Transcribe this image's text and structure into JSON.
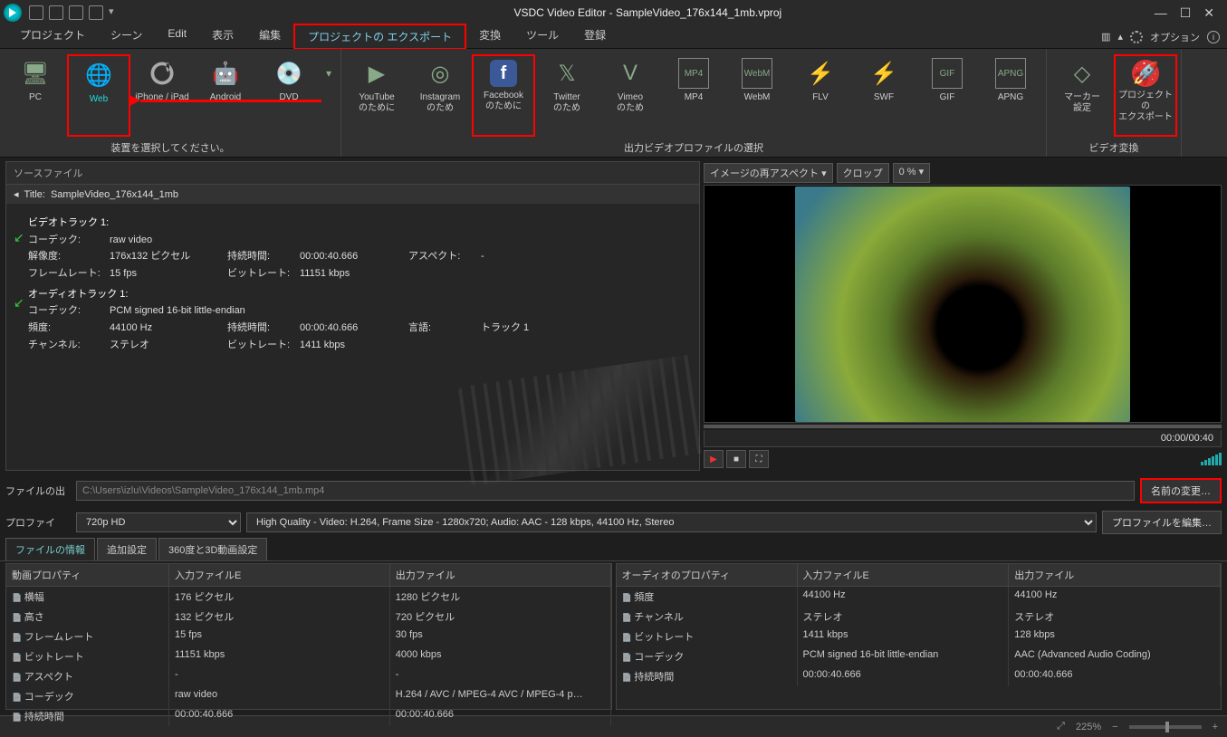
{
  "titlebar": {
    "title": "VSDC Video Editor - SampleVideo_176x144_1mb.vproj"
  },
  "menu": {
    "items": [
      "プロジェクト",
      "シーン",
      "Edit",
      "表示",
      "編集",
      "プロジェクトの エクスポート",
      "変換",
      "ツール",
      "登録"
    ],
    "highlight_index": 5,
    "options_label": "オプション"
  },
  "ribbon": {
    "group_device": {
      "caption": "装置を選択してください。",
      "items": [
        {
          "label": "PC"
        },
        {
          "label": "Web"
        },
        {
          "label": "iPhone / iPad"
        },
        {
          "label": "Android"
        },
        {
          "label": "DVD"
        }
      ],
      "highlight_index": 1
    },
    "group_profiles": {
      "caption": "出力ビデオプロファイルの選択",
      "items": [
        {
          "label": "YouTube\nのために"
        },
        {
          "label": "Instagram\nのため"
        },
        {
          "label": "Facebook\nのために"
        },
        {
          "label": "Twitter\nのため"
        },
        {
          "label": "Vimeo\nのため"
        },
        {
          "label": "MP4"
        },
        {
          "label": "WebM"
        },
        {
          "label": "FLV"
        },
        {
          "label": "SWF"
        },
        {
          "label": "GIF"
        },
        {
          "label": "APNG"
        }
      ],
      "highlight_index": 2
    },
    "group_convert": {
      "caption": "ビデオ変換",
      "items": [
        {
          "label": "マーカー\n設定"
        },
        {
          "label": "プロジェクトの\nエクスポート"
        }
      ],
      "highlight_index": 1
    }
  },
  "source": {
    "panel_title": "ソースファイル",
    "title_prefix": "Title:",
    "title": "SampleVideo_176x144_1mb",
    "video_track": {
      "heading": "ビデオトラック 1:",
      "codec_label": "コーデック:",
      "codec": "raw video",
      "res_label": "解像度:",
      "res": "176x132 ピクセル",
      "dur_label": "持続時間:",
      "dur": "00:00:40.666",
      "aspect_label": "アスペクト:",
      "aspect": "-",
      "fps_label": "フレームレート:",
      "fps": "15 fps",
      "br_label": "ビットレート:",
      "br": "11151 kbps"
    },
    "audio_track": {
      "heading": "オーディオトラック 1:",
      "codec_label": "コーデック:",
      "codec": "PCM signed 16-bit little-endian",
      "freq_label": "頻度:",
      "freq": "44100 Hz",
      "dur_label": "持続時間:",
      "dur": "00:00:40.666",
      "lang_label": "言語:",
      "lang": "トラック 1",
      "ch_label": "チャンネル:",
      "ch": "ステレオ",
      "br_label": "ビットレート:",
      "br": "1411 kbps"
    }
  },
  "preview": {
    "aspect_label": "イメージの再アスペクト",
    "crop_label": "クロップ",
    "crop_value": "0 %",
    "time": "00:00/00:40"
  },
  "output": {
    "path_label": "ファイルの出",
    "path": "C:\\Users\\izlu\\Videos\\SampleVideo_176x144_1mb.mp4",
    "rename_btn": "名前の変更…",
    "profile_label": "プロファイ",
    "profile1": "720p HD",
    "profile2": "High Quality - Video: H.264, Frame Size - 1280x720; Audio: AAC - 128 kbps, 44100 Hz, Stereo",
    "edit_profile_btn": "プロファイルを編集…"
  },
  "tabs": {
    "items": [
      "ファイルの情報",
      "追加設定",
      "360度と3D動画設定"
    ],
    "active": 0
  },
  "props": {
    "video": {
      "headers": [
        "動画プロパティ",
        "入力ファイルE",
        "出力ファイル"
      ],
      "rows": [
        [
          "横幅",
          "176 ピクセル",
          "1280 ピクセル"
        ],
        [
          "高さ",
          "132 ピクセル",
          "720 ピクセル"
        ],
        [
          "フレームレート",
          "15 fps",
          "30 fps"
        ],
        [
          "ビットレート",
          "11151 kbps",
          "4000 kbps"
        ],
        [
          "アスペクト",
          "-",
          "-"
        ],
        [
          "コーデック",
          "raw video",
          "H.264 / AVC / MPEG-4 AVC / MPEG-4 p…"
        ],
        [
          "持続時間",
          "00:00:40.666",
          "00:00:40.666"
        ]
      ]
    },
    "audio": {
      "headers": [
        "オーディオのプロパティ",
        "入力ファイルE",
        "出力ファイル"
      ],
      "rows": [
        [
          "頻度",
          "44100 Hz",
          "44100 Hz"
        ],
        [
          "チャンネル",
          "ステレオ",
          "ステレオ"
        ],
        [
          "ビットレート",
          "1411 kbps",
          "128 kbps"
        ],
        [
          "コーデック",
          "PCM signed 16-bit little-endian",
          "AAC (Advanced Audio Coding)"
        ],
        [
          "持続時間",
          "00:00:40.666",
          "00:00:40.666"
        ]
      ]
    }
  },
  "statusbar": {
    "zoom": "225%"
  }
}
